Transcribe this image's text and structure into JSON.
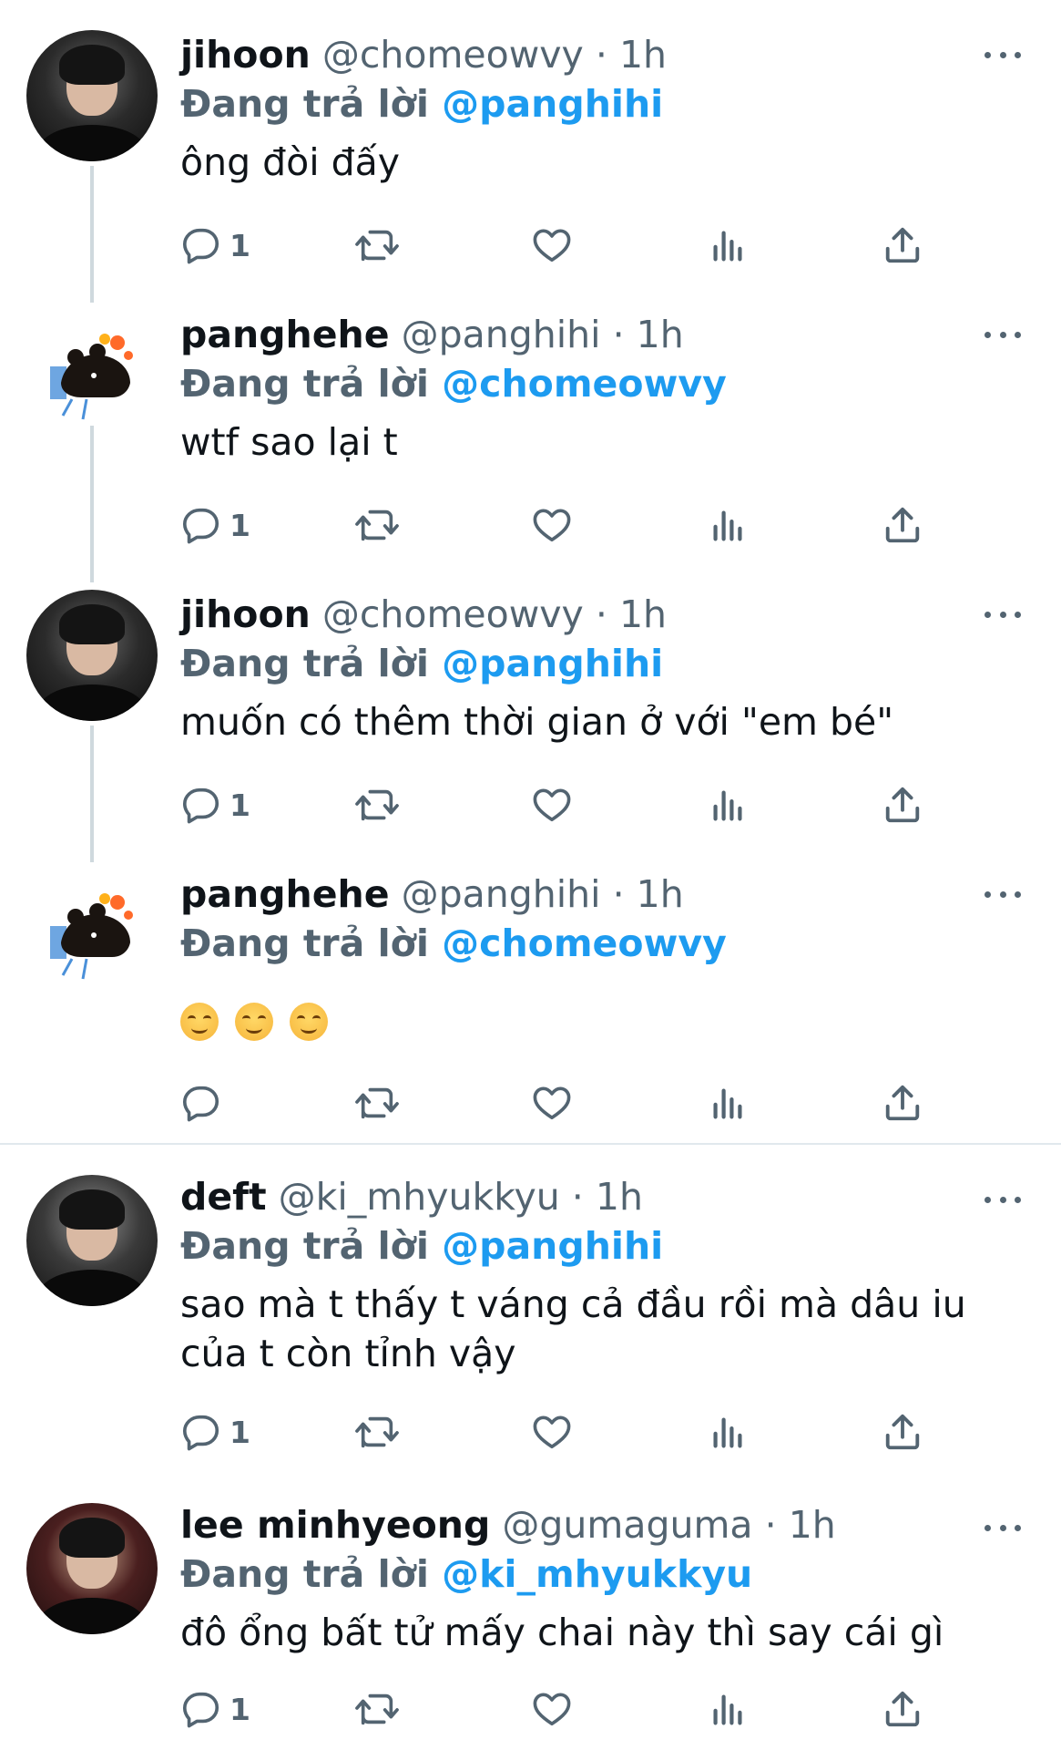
{
  "replies": [
    {
      "name": "jihoon",
      "handle": "@chomeowvy",
      "time": "1h",
      "replying_prefix": "Đang trả lời",
      "replying_to": "@panghihi",
      "text": "ông đòi đấy",
      "reply_count": "1",
      "avatar_icon": "avatar-photo"
    },
    {
      "name": "panghehe",
      "handle": "@panghihi",
      "time": "1h",
      "replying_prefix": "Đang trả lời",
      "replying_to": "@chomeowvy",
      "text": "wtf sao lại t",
      "reply_count": "1",
      "avatar_icon": "bear-sticker-icon"
    },
    {
      "name": "jihoon",
      "handle": "@chomeowvy",
      "time": "1h",
      "replying_prefix": "Đang trả lời",
      "replying_to": "@panghihi",
      "text": "muốn có thêm thời gian ở với \"em bé\"",
      "reply_count": "1",
      "avatar_icon": "avatar-photo"
    },
    {
      "name": "panghehe",
      "handle": "@panghihi",
      "time": "1h",
      "replying_prefix": "Đang trả lời",
      "replying_to": "@chomeowvy",
      "emojis": [
        "smiling-face-icon",
        "smiling-face-icon",
        "smiling-face-icon"
      ],
      "reply_count": "",
      "avatar_icon": "bear-sticker-icon"
    },
    {
      "name": "deft",
      "handle": "@ki_mhyukkyu",
      "time": "1h",
      "replying_prefix": "Đang trả lời",
      "replying_to": "@panghihi",
      "text_line1": "sao mà t thấy t váng cả đầu rồi mà dâu iu",
      "text_line2": "của t còn tỉnh vậy",
      "reply_count": "1",
      "avatar_icon": "avatar-photo"
    },
    {
      "name": "lee minhyeong",
      "handle": "@gumaguma",
      "time": "1h",
      "replying_prefix": "Đang trả lời",
      "replying_to": "@ki_mhyukkyu",
      "text": "đô ổng bất tử mấy chai này thì say cái gì",
      "reply_count": "1",
      "avatar_icon": "avatar-photo"
    }
  ],
  "separator": "·",
  "colors": {
    "text": "#0f1419",
    "secondary": "#536471",
    "accent": "#1d9bf0",
    "thread_line": "#cfd9de",
    "divider": "#e1e8ed"
  }
}
